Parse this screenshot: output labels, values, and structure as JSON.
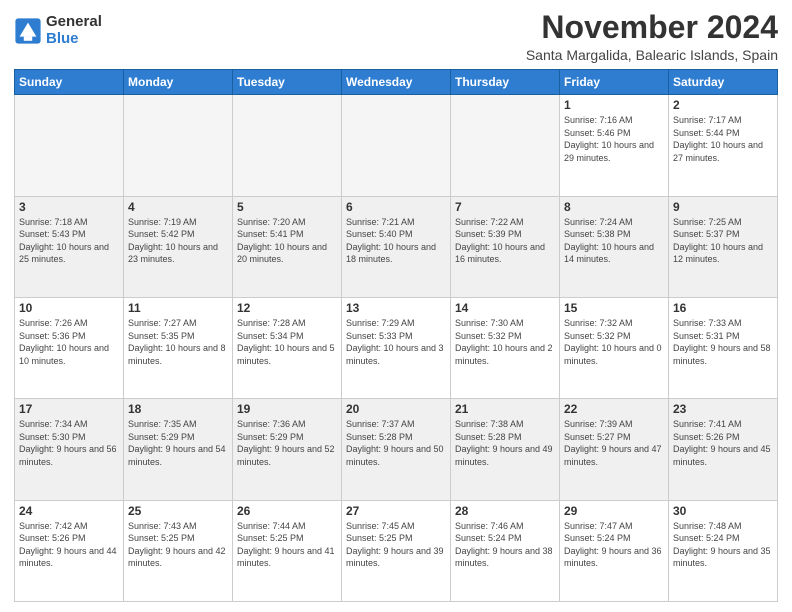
{
  "logo": {
    "general": "General",
    "blue": "Blue"
  },
  "header": {
    "month": "November 2024",
    "location": "Santa Margalida, Balearic Islands, Spain"
  },
  "days_of_week": [
    "Sunday",
    "Monday",
    "Tuesday",
    "Wednesday",
    "Thursday",
    "Friday",
    "Saturday"
  ],
  "weeks": [
    {
      "days": [
        {
          "num": "",
          "empty": true
        },
        {
          "num": "",
          "empty": true
        },
        {
          "num": "",
          "empty": true
        },
        {
          "num": "",
          "empty": true
        },
        {
          "num": "",
          "empty": true
        },
        {
          "num": "1",
          "sunrise": "7:16 AM",
          "sunset": "5:46 PM",
          "daylight": "10 hours and 29 minutes."
        },
        {
          "num": "2",
          "sunrise": "7:17 AM",
          "sunset": "5:44 PM",
          "daylight": "10 hours and 27 minutes."
        }
      ]
    },
    {
      "shade": true,
      "days": [
        {
          "num": "3",
          "sunrise": "7:18 AM",
          "sunset": "5:43 PM",
          "daylight": "10 hours and 25 minutes."
        },
        {
          "num": "4",
          "sunrise": "7:19 AM",
          "sunset": "5:42 PM",
          "daylight": "10 hours and 23 minutes."
        },
        {
          "num": "5",
          "sunrise": "7:20 AM",
          "sunset": "5:41 PM",
          "daylight": "10 hours and 20 minutes."
        },
        {
          "num": "6",
          "sunrise": "7:21 AM",
          "sunset": "5:40 PM",
          "daylight": "10 hours and 18 minutes."
        },
        {
          "num": "7",
          "sunrise": "7:22 AM",
          "sunset": "5:39 PM",
          "daylight": "10 hours and 16 minutes."
        },
        {
          "num": "8",
          "sunrise": "7:24 AM",
          "sunset": "5:38 PM",
          "daylight": "10 hours and 14 minutes."
        },
        {
          "num": "9",
          "sunrise": "7:25 AM",
          "sunset": "5:37 PM",
          "daylight": "10 hours and 12 minutes."
        }
      ]
    },
    {
      "days": [
        {
          "num": "10",
          "sunrise": "7:26 AM",
          "sunset": "5:36 PM",
          "daylight": "10 hours and 10 minutes."
        },
        {
          "num": "11",
          "sunrise": "7:27 AM",
          "sunset": "5:35 PM",
          "daylight": "10 hours and 8 minutes."
        },
        {
          "num": "12",
          "sunrise": "7:28 AM",
          "sunset": "5:34 PM",
          "daylight": "10 hours and 5 minutes."
        },
        {
          "num": "13",
          "sunrise": "7:29 AM",
          "sunset": "5:33 PM",
          "daylight": "10 hours and 3 minutes."
        },
        {
          "num": "14",
          "sunrise": "7:30 AM",
          "sunset": "5:32 PM",
          "daylight": "10 hours and 2 minutes."
        },
        {
          "num": "15",
          "sunrise": "7:32 AM",
          "sunset": "5:32 PM",
          "daylight": "10 hours and 0 minutes."
        },
        {
          "num": "16",
          "sunrise": "7:33 AM",
          "sunset": "5:31 PM",
          "daylight": "9 hours and 58 minutes."
        }
      ]
    },
    {
      "shade": true,
      "days": [
        {
          "num": "17",
          "sunrise": "7:34 AM",
          "sunset": "5:30 PM",
          "daylight": "9 hours and 56 minutes."
        },
        {
          "num": "18",
          "sunrise": "7:35 AM",
          "sunset": "5:29 PM",
          "daylight": "9 hours and 54 minutes."
        },
        {
          "num": "19",
          "sunrise": "7:36 AM",
          "sunset": "5:29 PM",
          "daylight": "9 hours and 52 minutes."
        },
        {
          "num": "20",
          "sunrise": "7:37 AM",
          "sunset": "5:28 PM",
          "daylight": "9 hours and 50 minutes."
        },
        {
          "num": "21",
          "sunrise": "7:38 AM",
          "sunset": "5:28 PM",
          "daylight": "9 hours and 49 minutes."
        },
        {
          "num": "22",
          "sunrise": "7:39 AM",
          "sunset": "5:27 PM",
          "daylight": "9 hours and 47 minutes."
        },
        {
          "num": "23",
          "sunrise": "7:41 AM",
          "sunset": "5:26 PM",
          "daylight": "9 hours and 45 minutes."
        }
      ]
    },
    {
      "days": [
        {
          "num": "24",
          "sunrise": "7:42 AM",
          "sunset": "5:26 PM",
          "daylight": "9 hours and 44 minutes."
        },
        {
          "num": "25",
          "sunrise": "7:43 AM",
          "sunset": "5:25 PM",
          "daylight": "9 hours and 42 minutes."
        },
        {
          "num": "26",
          "sunrise": "7:44 AM",
          "sunset": "5:25 PM",
          "daylight": "9 hours and 41 minutes."
        },
        {
          "num": "27",
          "sunrise": "7:45 AM",
          "sunset": "5:25 PM",
          "daylight": "9 hours and 39 minutes."
        },
        {
          "num": "28",
          "sunrise": "7:46 AM",
          "sunset": "5:24 PM",
          "daylight": "9 hours and 38 minutes."
        },
        {
          "num": "29",
          "sunrise": "7:47 AM",
          "sunset": "5:24 PM",
          "daylight": "9 hours and 36 minutes."
        },
        {
          "num": "30",
          "sunrise": "7:48 AM",
          "sunset": "5:24 PM",
          "daylight": "9 hours and 35 minutes."
        }
      ]
    }
  ],
  "labels": {
    "sunrise": "Sunrise:",
    "sunset": "Sunset:",
    "daylight": "Daylight:"
  }
}
